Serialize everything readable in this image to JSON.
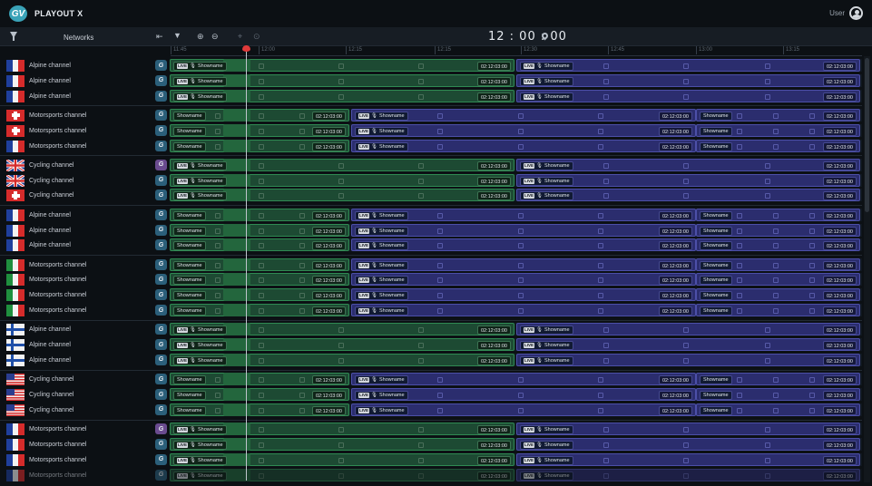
{
  "app": {
    "title": "PLAYOUT X",
    "logo_text": "GV",
    "user_label": "User"
  },
  "toolbar": {
    "networks_label": "Networks",
    "clock": "12 : 00 : 00"
  },
  "ruler": {
    "ticks": [
      "11:45",
      "12:00",
      "12:15",
      "12:15",
      "12:30",
      "12:45",
      "13:00",
      "13:15"
    ]
  },
  "labels": {
    "showname": "Showname",
    "duration": "02:12:03:00",
    "live": "LIVE"
  },
  "channels": [
    {
      "name": "Alpine channel",
      "flag": "fr",
      "pattern": "A",
      "icon": "blue"
    },
    {
      "name": "Alpine channel",
      "flag": "fr",
      "pattern": "A",
      "icon": "blue"
    },
    {
      "name": "Alpine channel",
      "flag": "fr",
      "pattern": "A",
      "icon": "blue"
    },
    {
      "name": "Motorsports channel",
      "flag": "ch",
      "pattern": "B",
      "icon": "blue"
    },
    {
      "name": "Motorsports channel",
      "flag": "ch",
      "pattern": "B",
      "icon": "blue"
    },
    {
      "name": "Motorsports channel",
      "flag": "fr",
      "pattern": "B",
      "icon": "blue"
    },
    {
      "name": "Cycling channel",
      "flag": "uk",
      "pattern": "A",
      "icon": "purple"
    },
    {
      "name": "Cycling channel",
      "flag": "uk",
      "pattern": "A",
      "icon": "blue"
    },
    {
      "name": "Cycling channel",
      "flag": "ch",
      "pattern": "A",
      "icon": "blue"
    },
    {
      "name": "Alpine channel",
      "flag": "fr",
      "pattern": "B",
      "icon": "blue"
    },
    {
      "name": "Alpine channel",
      "flag": "fr",
      "pattern": "B",
      "icon": "blue"
    },
    {
      "name": "Alpine channel",
      "flag": "fr",
      "pattern": "B",
      "icon": "blue"
    },
    {
      "name": "Motorsports channel",
      "flag": "it",
      "pattern": "B",
      "icon": "blue"
    },
    {
      "name": "Motorsports channel",
      "flag": "it",
      "pattern": "B",
      "icon": "blue"
    },
    {
      "name": "Motorsports channel",
      "flag": "it",
      "pattern": "B",
      "icon": "blue"
    },
    {
      "name": "Motorsports channel",
      "flag": "it",
      "pattern": "B",
      "icon": "blue"
    },
    {
      "name": "Alpine channel",
      "flag": "fi",
      "pattern": "A",
      "icon": "blue"
    },
    {
      "name": "Alpine channel",
      "flag": "fi",
      "pattern": "A",
      "icon": "blue"
    },
    {
      "name": "Alpine channel",
      "flag": "fi",
      "pattern": "A",
      "icon": "blue"
    },
    {
      "name": "Cycling channel",
      "flag": "us",
      "pattern": "B",
      "icon": "blue"
    },
    {
      "name": "Cycling channel",
      "flag": "us",
      "pattern": "B",
      "icon": "blue"
    },
    {
      "name": "Cycling channel",
      "flag": "us",
      "pattern": "B",
      "icon": "blue"
    },
    {
      "name": "Motorsports channel",
      "flag": "fr",
      "pattern": "A",
      "icon": "purple"
    },
    {
      "name": "Motorsports channel",
      "flag": "fr",
      "pattern": "A",
      "icon": "blue"
    },
    {
      "name": "Motorsports channel",
      "flag": "fr",
      "pattern": "A",
      "icon": "blue"
    },
    {
      "name": "Motorsports channel",
      "flag": "fr",
      "pattern": "A",
      "icon": "blue",
      "dimmed": true
    }
  ],
  "colors": {
    "green": "#2f8a52",
    "purple": "#4c4fa8",
    "playhead": "#e03a3a"
  }
}
